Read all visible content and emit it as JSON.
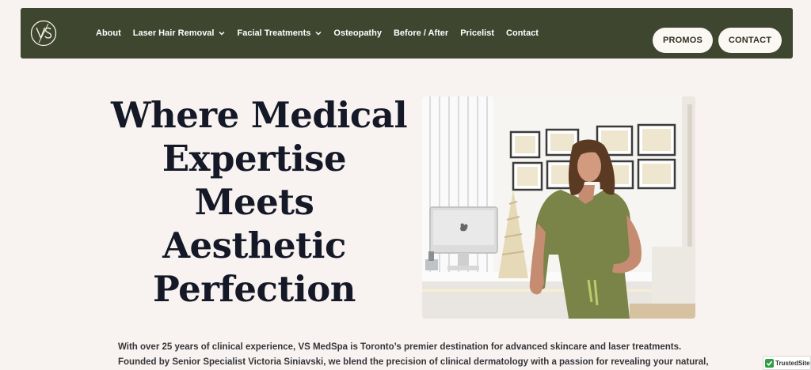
{
  "brand": {
    "logo_text": "VS"
  },
  "nav": {
    "items": [
      {
        "label": "About",
        "has_dropdown": false
      },
      {
        "label": "Laser Hair Removal",
        "has_dropdown": true
      },
      {
        "label": "Facial Treatments",
        "has_dropdown": true
      },
      {
        "label": "Osteopathy",
        "has_dropdown": false
      },
      {
        "label": "Before / After",
        "has_dropdown": false
      },
      {
        "label": "Pricelist",
        "has_dropdown": false
      },
      {
        "label": "Contact",
        "has_dropdown": false
      }
    ],
    "promos_label": "PROMOS",
    "contact_label": "CONTACT"
  },
  "hero": {
    "title_lines": [
      "Where Medical",
      "Expertise",
      "Meets",
      "Aesthetic",
      "Perfection"
    ],
    "intro_lines": [
      "With over 25 years of clinical experience, VS MedSpa is Toronto’s premier destination for advanced skincare and laser treatments.",
      "Founded by Senior Specialist Victoria Siniavski, we blend the precision of clinical dermatology with a passion for revealing your natural,"
    ]
  },
  "badge": {
    "label": "TrustedSite"
  },
  "colors": {
    "nav_bg": "#3e4630",
    "page_bg": "#f8f3f0",
    "pill_bg": "#fbf7f3",
    "title": "#141827"
  }
}
